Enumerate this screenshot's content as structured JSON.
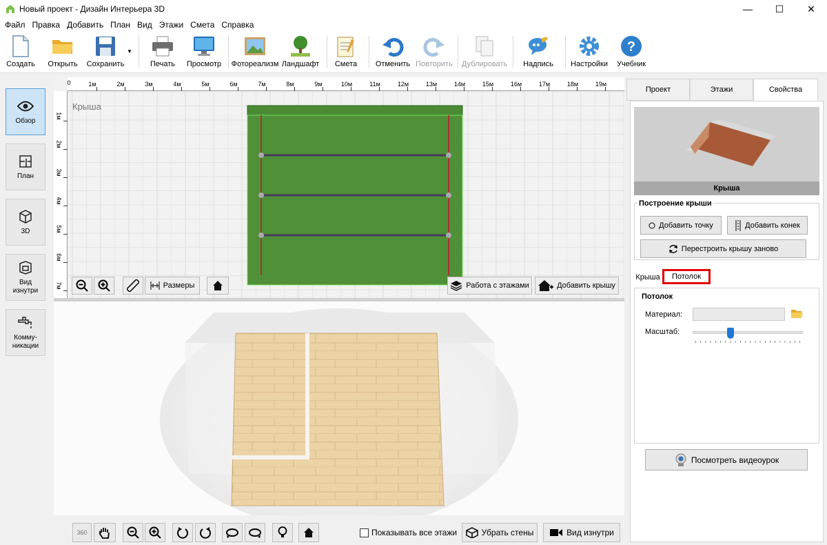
{
  "window": {
    "title": "Новый проект - Дизайн Интерьера 3D",
    "minimize": "—",
    "maximize": "☐",
    "close": "✕"
  },
  "menu": [
    "Файл",
    "Правка",
    "Добавить",
    "План",
    "Вид",
    "Этажи",
    "Смета",
    "Справка"
  ],
  "toolbar": {
    "create": "Создать",
    "open": "Открыть",
    "save": "Сохранить",
    "print": "Печать",
    "preview": "Просмотр",
    "photo": "Фотореализм",
    "landscape": "Ландшафт",
    "estimate": "Смета",
    "undo": "Отменить",
    "redo": "Повторить",
    "duplicate": "Дублировать",
    "label": "Надпись",
    "settings": "Настройки",
    "tutorial": "Учебник"
  },
  "nav": {
    "overview": "Обзор",
    "plan": "План",
    "view3d": "3D",
    "inside": "Вид изнутри",
    "utilities": "Комму-никации"
  },
  "plan": {
    "label": "Крыша",
    "ruler_x": [
      "1м",
      "2м",
      "3м",
      "4м",
      "5м",
      "6м",
      "7м",
      "8м",
      "9м",
      "10м",
      "11м",
      "12м",
      "13м",
      "14м",
      "15м",
      "16м",
      "17м",
      "18м",
      "19м"
    ],
    "ruler_x_zero": "0",
    "ruler_y": [
      "1м",
      "2м",
      "3м",
      "4м",
      "5м",
      "6м",
      "7м"
    ],
    "sizes": "Размеры",
    "floors": "Работа с этажами",
    "add_roof": "Добавить крышу"
  },
  "bottom": {
    "show_all_floors": "Показывать все этажи",
    "remove_walls": "Убрать стены",
    "inside_view": "Вид изнутри",
    "rotate360": "360"
  },
  "right": {
    "tabs": [
      "Проект",
      "Этажи",
      "Свойства"
    ],
    "active_tab": "Свойства",
    "preview_caption": "Крыша",
    "roof_group": "Построение крыши",
    "add_point": "Добавить точку",
    "add_ridge": "Добавить конек",
    "rebuild": "Перестроить крышу заново",
    "subtabs": [
      "Крыша",
      "Потолок"
    ],
    "ceiling_group": "Потолок",
    "material_label": "Материал:",
    "scale_label": "Масштаб:",
    "scale_value": 0.33,
    "video": "Посмотреть видеоурок"
  },
  "colors": {
    "roof_green": "#4a8a34",
    "accent_red": "#e00000",
    "floor_wood": "#ecd3a6"
  }
}
